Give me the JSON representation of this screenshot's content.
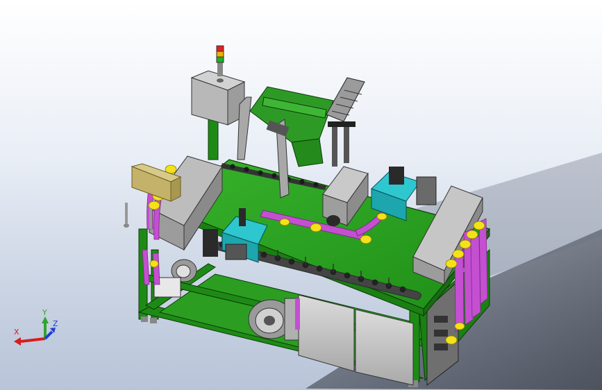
{
  "triad": {
    "x_label": "X",
    "y_label": "Y",
    "z_label": "Z",
    "x_color": "#d81c1c",
    "y_color": "#2fa52f",
    "z_color": "#1f3fd6"
  },
  "colors": {
    "deck": "#25a31a",
    "frame": "#1e8a16",
    "enclosure": "#c8c8c8",
    "cyan_module": "#2fc7cf",
    "pipe": "#c44fd1",
    "fitting": "#f3e11a",
    "dark_part": "#2a2a2a"
  }
}
